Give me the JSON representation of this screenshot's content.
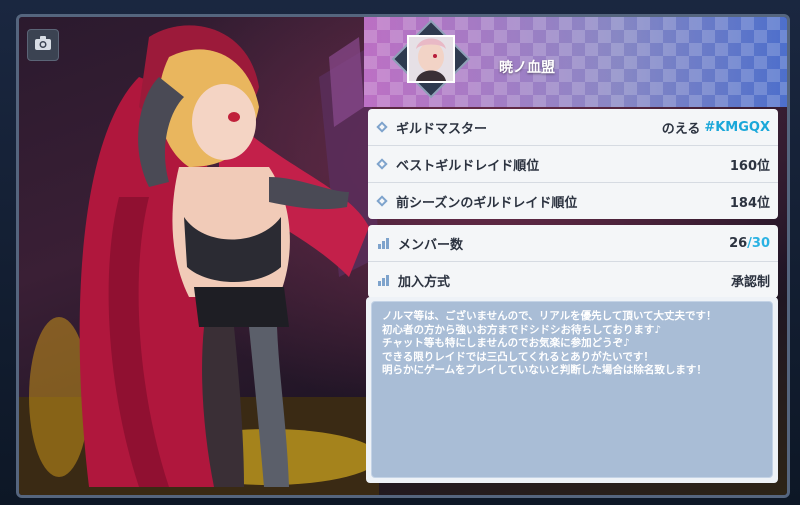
{
  "guild": {
    "name": "暁ノ血盟",
    "emblem_icon": "character-portrait-emblem"
  },
  "camera_icon": "camera-icon",
  "info": {
    "master_label": "ギルドマスター",
    "master_name": "のえる",
    "master_tag": "#KMGQX",
    "best_raid_label": "ベストギルドレイド順位",
    "best_raid_value": "160位",
    "prev_raid_label": "前シーズンのギルドレイド順位",
    "prev_raid_value": "184位"
  },
  "members": {
    "label": "メンバー数",
    "count": "26",
    "separator": "/",
    "max": "30"
  },
  "join": {
    "label": "加入方式",
    "value": "承認制"
  },
  "description": {
    "lines": [
      "ノルマ等は、ございませんので、リアルを優先して頂いて大丈夫です！",
      "初心者の方から強いお方までドシドシお待ちしております♪",
      "チャット等も特にしませんのでお気楽に参加どうぞ♪",
      "できる限りレイドでは三凸してくれるとありがたいです！",
      "明らかにゲームをプレイしていないと判断した場合は除名致します！"
    ]
  },
  "colors": {
    "accent": "#1aa7d9",
    "panel": "#f4f6f8",
    "desc_bg": "#a9bdd6"
  }
}
